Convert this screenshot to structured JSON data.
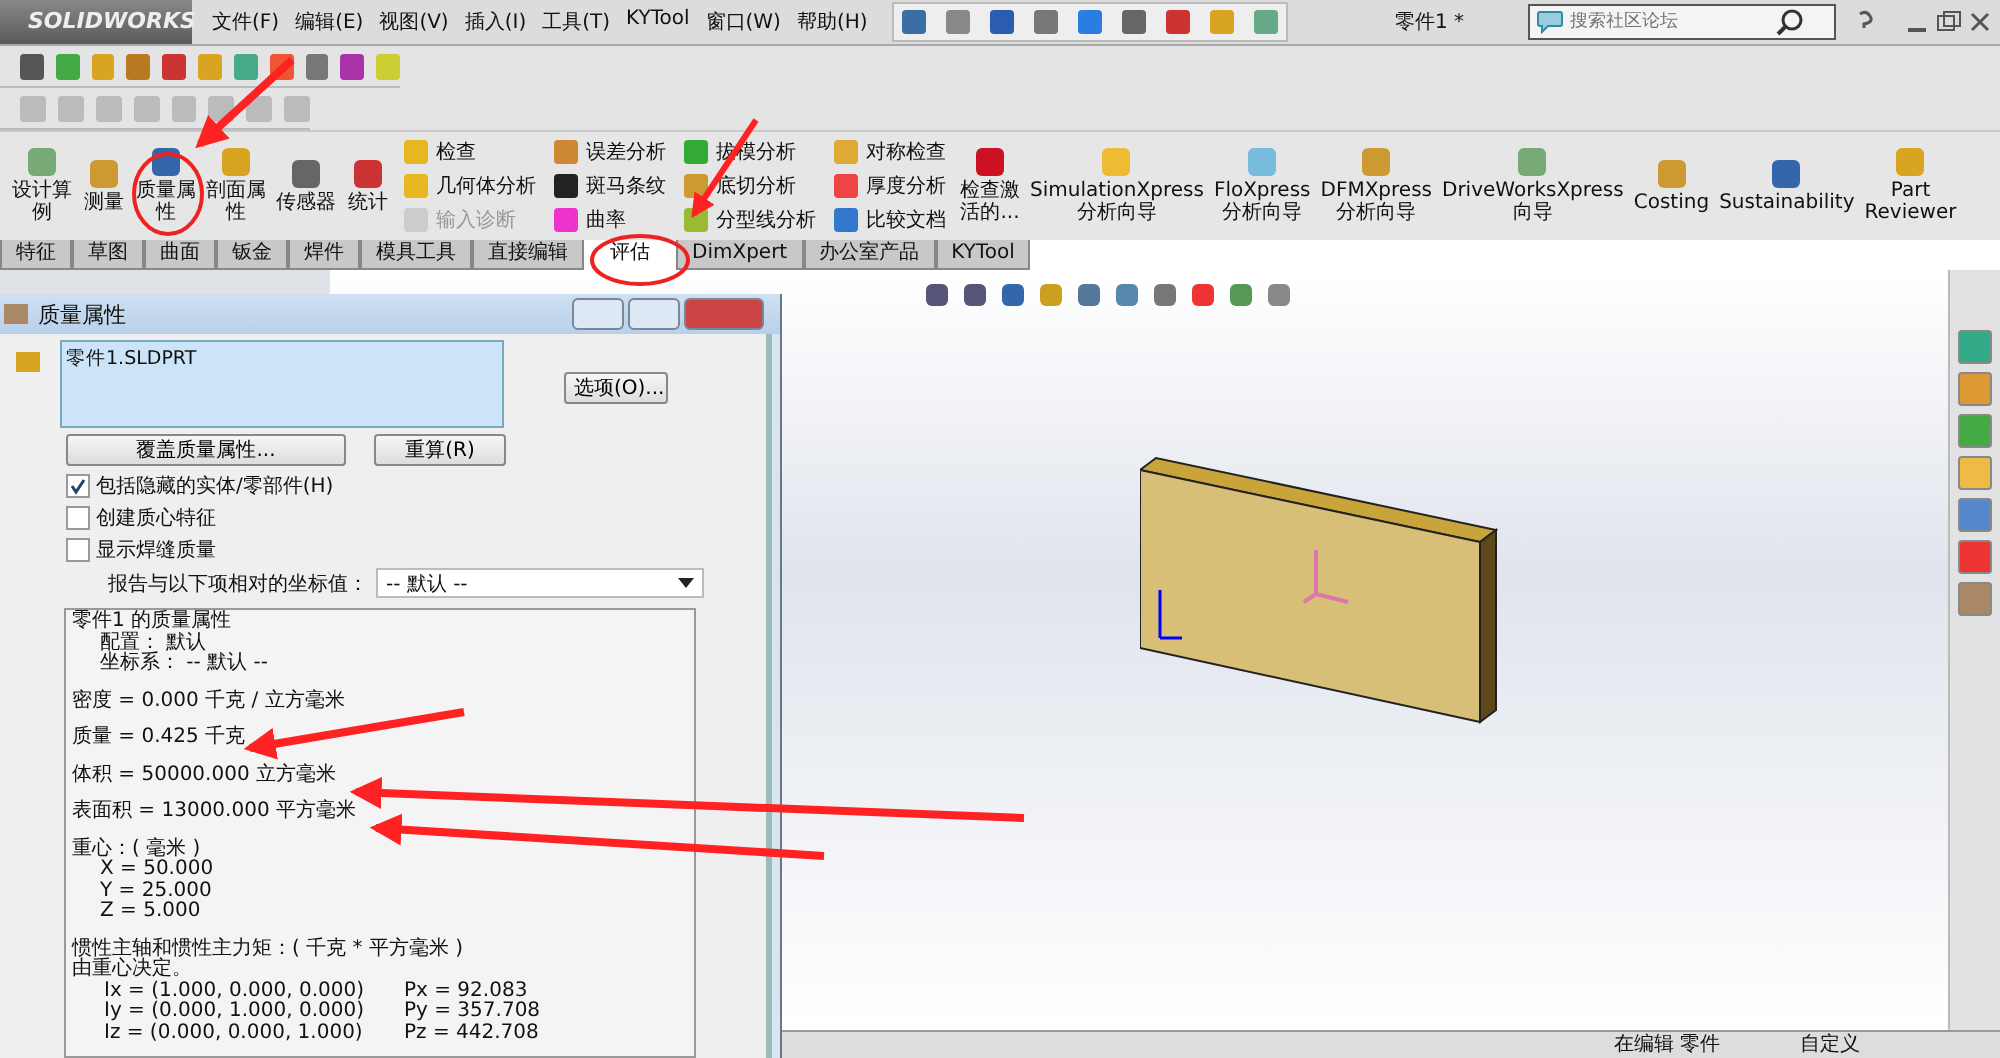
{
  "app": {
    "logo": "SOLIDWORKS",
    "menus": [
      "文件(F)",
      "编辑(E)",
      "视图(V)",
      "插入(I)",
      "工具(T)",
      "KYTool",
      "窗口(W)",
      "帮助(H)"
    ],
    "document_title": "零件1 *",
    "search": {
      "placeholder": "搜索社区论坛"
    }
  },
  "ribbon": {
    "items": [
      {
        "kind": "large",
        "lines": [
          "设计算",
          "例"
        ]
      },
      {
        "kind": "large",
        "lines": [
          "测量"
        ]
      },
      {
        "kind": "large",
        "lines": [
          "质量属",
          "性"
        ]
      },
      {
        "kind": "large",
        "lines": [
          "剖面属",
          "性"
        ]
      },
      {
        "kind": "large",
        "lines": [
          "传感器"
        ]
      },
      {
        "kind": "large",
        "lines": [
          "统计"
        ]
      },
      {
        "kind": "stack",
        "entries": [
          {
            "label": "检查",
            "disabled": false
          },
          {
            "label": "几何体分析",
            "disabled": false
          },
          {
            "label": "输入诊断",
            "disabled": true
          }
        ]
      },
      {
        "kind": "stack",
        "entries": [
          {
            "label": "误差分析",
            "disabled": false
          },
          {
            "label": "斑马条纹",
            "disabled": false
          },
          {
            "label": "曲率",
            "disabled": false
          }
        ]
      },
      {
        "kind": "stack",
        "entries": [
          {
            "label": "拔模分析",
            "disabled": false
          },
          {
            "label": "底切分析",
            "disabled": false
          },
          {
            "label": "分型线分析",
            "disabled": false
          }
        ]
      },
      {
        "kind": "stack",
        "entries": [
          {
            "label": "对称检查",
            "disabled": false
          },
          {
            "label": "厚度分析",
            "disabled": false
          },
          {
            "label": "比较文档",
            "disabled": false
          }
        ]
      },
      {
        "kind": "large",
        "lines": [
          "检查激",
          "活的..."
        ]
      },
      {
        "kind": "large",
        "lines": [
          "SimulationXpress",
          "分析向导"
        ]
      },
      {
        "kind": "large",
        "lines": [
          "FloXpress",
          "分析向导"
        ]
      },
      {
        "kind": "large",
        "lines": [
          "DFMXpress",
          "分析向导"
        ]
      },
      {
        "kind": "large",
        "lines": [
          "DriveWorksXpress",
          "向导"
        ]
      },
      {
        "kind": "large",
        "lines": [
          "Costing"
        ]
      },
      {
        "kind": "large",
        "lines": [
          "Sustainability"
        ]
      },
      {
        "kind": "large",
        "lines": [
          "Part",
          "Reviewer"
        ]
      }
    ]
  },
  "tabs": [
    {
      "label": "特征",
      "selected": false
    },
    {
      "label": "草图",
      "selected": false
    },
    {
      "label": "曲面",
      "selected": false
    },
    {
      "label": "钣金",
      "selected": false
    },
    {
      "label": "焊件",
      "selected": false
    },
    {
      "label": "模具工具",
      "selected": false
    },
    {
      "label": "直接编辑",
      "selected": false
    },
    {
      "label": "评估",
      "selected": true
    },
    {
      "label": "DimXpert",
      "selected": false
    },
    {
      "label": "办公室产品",
      "selected": false
    },
    {
      "label": "KYTool",
      "selected": false
    }
  ],
  "dialog": {
    "title": "质量属性",
    "selection": [
      "零件1.SLDPRT"
    ],
    "options_button": "选项(O)...",
    "override_button": "覆盖质量属性...",
    "recalc_button": "重算(R)",
    "checkboxes": [
      {
        "label": "包括隐藏的实体/零部件(H)",
        "checked": true
      },
      {
        "label": "创建质心特征",
        "checked": false
      },
      {
        "label": "显示焊缝质量",
        "checked": false
      }
    ],
    "coordinate_label": "报告与以下项相对的坐标值：",
    "coordinate_value": "-- 默认 --",
    "report": [
      {
        "lines": [
          {
            "kind": "main",
            "text": "零件1 的质量属性"
          },
          {
            "kind": "sub",
            "text": "配置： 默认"
          },
          {
            "kind": "sub",
            "text": "坐标系： -- 默认 --"
          }
        ]
      },
      {
        "lines": [
          {
            "kind": "main",
            "text": "密度 = 0.000 千克 / 立方毫米"
          }
        ]
      },
      {
        "lines": [
          {
            "kind": "main",
            "text": "质量 = 0.425 千克"
          }
        ]
      },
      {
        "lines": [
          {
            "kind": "main",
            "text": "体积 = 50000.000 立方毫米"
          }
        ]
      },
      {
        "lines": [
          {
            "kind": "main",
            "text": "表面积 = 13000.000  平方毫米"
          }
        ]
      },
      {
        "lines": [
          {
            "kind": "main",
            "text": "重心：( 毫米 )"
          },
          {
            "kind": "sub",
            "text": "X = 50.000"
          },
          {
            "kind": "sub",
            "text": "Y = 25.000"
          },
          {
            "kind": "sub",
            "text": "Z = 5.000"
          }
        ]
      },
      {
        "lines": [
          {
            "kind": "main",
            "text": "惯性主轴和惯性主力矩：( 千克 *  平方毫米 )"
          },
          {
            "kind": "main",
            "text": "由重心决定。"
          },
          {
            "kind": "axis",
            "text": "Ix = (1.000, 0.000, 0.000)",
            "value": "Px = 92.083"
          },
          {
            "kind": "axis",
            "text": "Iy = (0.000, 1.000, 0.000)",
            "value": "Py = 357.708"
          },
          {
            "kind": "axis",
            "text": "Iz = (0.000, 0.000, 1.000)",
            "value": "Pz = 442.708"
          }
        ]
      }
    ]
  },
  "status_bar": [
    "在编辑 零件",
    "自定义"
  ]
}
